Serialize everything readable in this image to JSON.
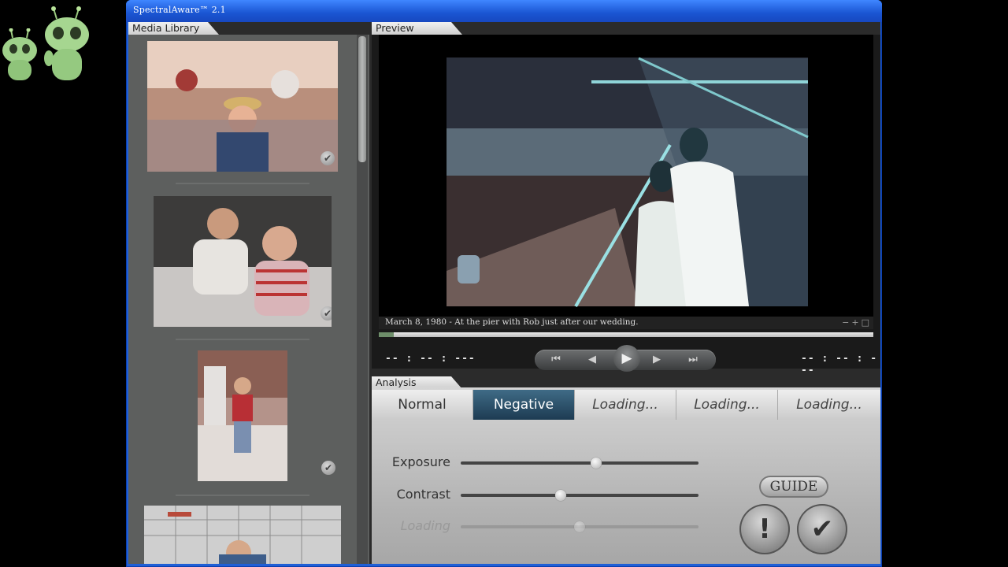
{
  "window": {
    "title": "SpectralAware™ 2.1"
  },
  "library": {
    "tab_label": "Media Library",
    "items": [
      {
        "name": "photo-1"
      },
      {
        "name": "photo-2"
      },
      {
        "name": "photo-3"
      },
      {
        "name": "photo-4"
      }
    ]
  },
  "preview": {
    "tab_label": "Preview",
    "caption": "March 8, 1980 - At the pier with Rob just after our wedding.",
    "zoom_icons": "−+□",
    "progress": 0.03,
    "time_current": "-- : -- : ---",
    "time_total": "-- : -- : ---"
  },
  "transport": {
    "first": "⏮",
    "prev": "◀",
    "play": "▶",
    "next": "▶",
    "last": "⏭"
  },
  "analysis": {
    "tab_label": "Analysis",
    "modes": [
      "Normal",
      "Negative",
      "Loading...",
      "Loading...",
      "Loading..."
    ],
    "active_mode": "Negative",
    "sliders": [
      {
        "label": "Exposure",
        "value": 0.57,
        "enabled": true
      },
      {
        "label": "Contrast",
        "value": 0.42,
        "enabled": true
      },
      {
        "label": "Loading",
        "value": 0.5,
        "enabled": false
      }
    ],
    "guide_label": "GUIDE",
    "alert_label": "!",
    "confirm_label": "✔"
  },
  "colors": {
    "title_bar": "#1a55d2",
    "active_mode": "#1d3b52",
    "panel_bg": "#5d5f5e"
  }
}
